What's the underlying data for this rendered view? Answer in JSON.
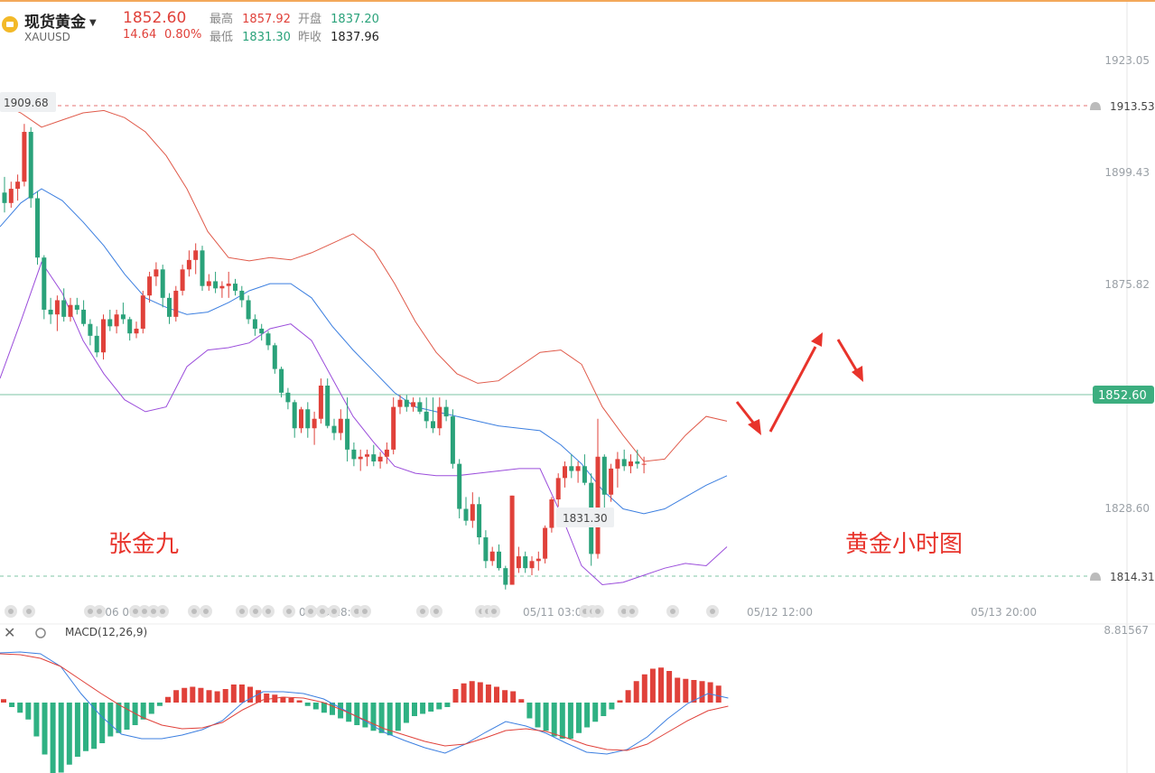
{
  "header": {
    "name": "现货黄金",
    "caret": "▼",
    "code": "XAUUSD",
    "last_price": "1852.60",
    "change": "14.64",
    "change_pct": "0.80%",
    "high_label": "最高",
    "high": "1857.92",
    "open_label": "开盘",
    "open": "1837.20",
    "low_label": "最低",
    "low": "1831.30",
    "prev_close_label": "昨收",
    "prev_close": "1837.96"
  },
  "annotations": {
    "author": "张金九",
    "chart_note": "黄金小时图",
    "max_tag": "1909.68",
    "min_tag": "1831.30",
    "alert_high": "1913.53",
    "alert_low": "1814.31",
    "current_price_tag": "1852.60",
    "macd_label": "MACD(12,26,9)",
    "macd_axis_value": "8.81567"
  },
  "colors": {
    "up": "#e0413a",
    "down": "#2aa27a",
    "boll_upper": "#e05a4a",
    "boll_mid": "#3c7fe0",
    "boll_lower": "#9b4ddb",
    "macd_dif": "#3c7fe0",
    "macd_dea": "#e0413a",
    "price_line": "#7cc6a6",
    "alert_line": "#e57373"
  },
  "chart_data": [
    {
      "type": "candlestick",
      "title": "",
      "y_ticks": [
        "1923.05",
        "1899.43",
        "1875.82",
        "1828.60"
      ],
      "ylim": [
        1808.6,
        1934.0
      ],
      "x_ticks": [
        "05/06 09:00",
        "05/09 18:00",
        "05/11 03:00",
        "05/12 12:00",
        "05/13 20:00"
      ],
      "current_price": 1852.6,
      "alert_levels": [
        1913.53,
        1814.31
      ],
      "candles": [
        [
          1895.2,
          1898.5,
          1891.0,
          1893.0
        ],
        [
          1893.0,
          1897.5,
          1892.0,
          1896.0
        ],
        [
          1896.0,
          1899.0,
          1893.5,
          1897.5
        ],
        [
          1897.5,
          1909.68,
          1896.5,
          1908.0
        ],
        [
          1908.0,
          1909.0,
          1892.0,
          1894.0
        ],
        [
          1894.0,
          1895.5,
          1880.0,
          1881.5
        ],
        [
          1881.5,
          1882.0,
          1868.5,
          1870.5
        ],
        [
          1870.5,
          1873.0,
          1867.5,
          1869.5
        ],
        [
          1869.5,
          1873.5,
          1866.0,
          1872.5
        ],
        [
          1872.5,
          1875.0,
          1868.0,
          1869.0
        ],
        [
          1869.0,
          1873.0,
          1868.0,
          1871.5
        ],
        [
          1871.5,
          1873.0,
          1869.5,
          1870.5
        ],
        [
          1870.5,
          1872.5,
          1867.0,
          1867.5
        ],
        [
          1867.5,
          1868.5,
          1863.0,
          1865.0
        ],
        [
          1865.0,
          1867.0,
          1860.5,
          1861.5
        ],
        [
          1861.5,
          1869.5,
          1860.0,
          1868.5
        ],
        [
          1868.5,
          1870.5,
          1866.0,
          1867.0
        ],
        [
          1867.0,
          1870.5,
          1865.5,
          1869.5
        ],
        [
          1869.5,
          1872.0,
          1867.5,
          1868.5
        ],
        [
          1868.5,
          1869.0,
          1864.0,
          1865.5
        ],
        [
          1865.5,
          1868.0,
          1864.5,
          1866.5
        ],
        [
          1866.5,
          1874.5,
          1865.5,
          1873.5
        ],
        [
          1873.5,
          1878.5,
          1872.0,
          1877.5
        ],
        [
          1877.5,
          1880.5,
          1875.5,
          1879.0
        ],
        [
          1879.0,
          1880.0,
          1871.0,
          1873.0
        ],
        [
          1873.0,
          1874.0,
          1867.5,
          1869.0
        ],
        [
          1869.0,
          1875.5,
          1868.0,
          1874.5
        ],
        [
          1874.5,
          1880.0,
          1873.5,
          1879.0
        ],
        [
          1879.0,
          1883.0,
          1877.5,
          1881.0
        ],
        [
          1881.0,
          1884.5,
          1878.0,
          1883.0
        ],
        [
          1883.0,
          1884.0,
          1874.5,
          1875.5
        ],
        [
          1875.5,
          1878.0,
          1874.5,
          1876.5
        ],
        [
          1876.5,
          1878.5,
          1874.0,
          1875.0
        ],
        [
          1875.0,
          1876.5,
          1873.0,
          1875.5
        ],
        [
          1875.5,
          1878.5,
          1873.0,
          1876.0
        ],
        [
          1876.0,
          1877.0,
          1873.5,
          1874.5
        ],
        [
          1874.5,
          1875.5,
          1871.0,
          1872.5
        ],
        [
          1872.5,
          1873.5,
          1867.5,
          1868.5
        ],
        [
          1868.5,
          1869.5,
          1865.0,
          1866.5
        ],
        [
          1866.5,
          1867.5,
          1864.0,
          1865.5
        ],
        [
          1865.5,
          1866.0,
          1862.0,
          1863.0
        ],
        [
          1863.0,
          1863.5,
          1857.0,
          1858.0
        ],
        [
          1858.0,
          1858.5,
          1852.0,
          1853.0
        ],
        [
          1853.0,
          1854.0,
          1849.5,
          1851.0
        ],
        [
          1851.0,
          1851.5,
          1843.5,
          1845.5
        ],
        [
          1845.5,
          1850.0,
          1844.5,
          1849.5
        ],
        [
          1849.5,
          1851.0,
          1843.5,
          1845.5
        ],
        [
          1845.5,
          1849.0,
          1842.0,
          1847.5
        ],
        [
          1847.5,
          1856.0,
          1846.5,
          1854.5
        ],
        [
          1854.5,
          1856.0,
          1845.5,
          1846.0
        ],
        [
          1846.0,
          1847.5,
          1843.0,
          1844.5
        ],
        [
          1844.5,
          1849.5,
          1843.0,
          1847.5
        ],
        [
          1847.5,
          1852.0,
          1838.5,
          1841.0
        ],
        [
          1841.0,
          1842.5,
          1837.5,
          1839.0
        ],
        [
          1839.0,
          1841.0,
          1836.5,
          1839.5
        ],
        [
          1839.5,
          1841.0,
          1837.5,
          1840.0
        ],
        [
          1840.0,
          1842.0,
          1837.5,
          1838.5
        ],
        [
          1838.5,
          1840.5,
          1837.0,
          1839.5
        ],
        [
          1839.5,
          1842.5,
          1838.0,
          1841.0
        ],
        [
          1841.0,
          1852.0,
          1840.0,
          1850.0
        ],
        [
          1850.0,
          1852.5,
          1848.5,
          1851.5
        ],
        [
          1851.5,
          1852.5,
          1849.0,
          1850.0
        ],
        [
          1850.0,
          1852.0,
          1849.0,
          1851.0
        ],
        [
          1851.0,
          1852.0,
          1848.5,
          1849.0
        ],
        [
          1849.0,
          1852.0,
          1845.5,
          1847.0
        ],
        [
          1847.0,
          1852.0,
          1844.5,
          1845.5
        ],
        [
          1845.5,
          1852.0,
          1844.0,
          1850.0
        ],
        [
          1850.0,
          1851.5,
          1847.0,
          1848.0
        ],
        [
          1848.0,
          1849.5,
          1837.0,
          1838.0
        ],
        [
          1838.0,
          1839.0,
          1826.5,
          1828.5
        ],
        [
          1828.5,
          1831.0,
          1825.0,
          1826.0
        ],
        [
          1826.0,
          1832.0,
          1824.5,
          1829.5
        ],
        [
          1829.5,
          1831.0,
          1821.0,
          1822.5
        ],
        [
          1822.5,
          1824.0,
          1816.0,
          1817.5
        ],
        [
          1817.5,
          1820.5,
          1816.5,
          1819.5
        ],
        [
          1819.5,
          1821.0,
          1815.5,
          1816.0
        ],
        [
          1816.0,
          1816.5,
          1811.5,
          1812.5
        ],
        [
          1812.5,
          1812.8,
          1831.3,
          1831.3
        ],
        [
          1816.0,
          1820.5,
          1815.0,
          1818.5
        ],
        [
          1818.5,
          1819.5,
          1815.0,
          1816.0
        ],
        [
          1816.0,
          1818.5,
          1814.5,
          1817.5
        ],
        [
          1817.5,
          1819.5,
          1815.5,
          1818.0
        ],
        [
          1818.0,
          1825.0,
          1817.0,
          1824.5
        ],
        [
          1824.5,
          1831.0,
          1823.5,
          1830.5
        ],
        [
          1830.5,
          1836.0,
          1829.0,
          1835.0
        ],
        [
          1835.0,
          1838.5,
          1833.0,
          1837.5
        ],
        [
          1837.5,
          1840.0,
          1835.0,
          1836.5
        ],
        [
          1836.5,
          1838.5,
          1834.0,
          1837.5
        ],
        [
          1837.5,
          1840.0,
          1833.5,
          1834.0
        ],
        [
          1834.0,
          1836.0,
          1816.5,
          1819.0
        ],
        [
          1819.0,
          1847.5,
          1818.0,
          1839.5
        ],
        [
          1839.5,
          1840.0,
          1828.5,
          1831.5
        ],
        [
          1831.5,
          1838.0,
          1830.0,
          1837.0
        ],
        [
          1837.0,
          1840.5,
          1833.0,
          1839.0
        ],
        [
          1839.0,
          1841.0,
          1836.5,
          1837.5
        ],
        [
          1837.5,
          1840.0,
          1836.0,
          1838.5
        ],
        [
          1838.5,
          1841.0,
          1837.0,
          1838.0
        ],
        [
          1838.0,
          1839.5,
          1836.0,
          1838.0
        ]
      ],
      "bollinger": {
        "upper": [
          1914.0,
          1912.0,
          1909.0,
          1910.5,
          1912.0,
          1912.5,
          1911.0,
          1908.0,
          1903.0,
          1896.0,
          1887.0,
          1881.5,
          1880.8,
          1881.5,
          1881.0,
          1882.5,
          1884.5,
          1886.5,
          1883.0,
          1876.0,
          1868.0,
          1861.5,
          1857.0,
          1855.0,
          1855.5,
          1858.5,
          1861.5,
          1862.0,
          1859.0,
          1850.0,
          1844.0,
          1838.5,
          1839.0,
          1844.0,
          1848.0,
          1847.0
        ],
        "mid": [
          1888.0,
          1893.0,
          1896.0,
          1893.5,
          1889.0,
          1884.0,
          1878.0,
          1873.0,
          1871.0,
          1869.5,
          1870.0,
          1872.0,
          1874.5,
          1876.0,
          1876.0,
          1873.0,
          1867.0,
          1862.0,
          1857.5,
          1853.0,
          1850.0,
          1849.0,
          1848.0,
          1847.0,
          1846.0,
          1845.5,
          1845.0,
          1842.0,
          1838.0,
          1832.5,
          1828.5,
          1827.5,
          1828.5,
          1831.0,
          1833.5,
          1835.5
        ],
        "lower": [
          1856.0,
          1868.0,
          1880.5,
          1874.0,
          1864.0,
          1857.0,
          1851.5,
          1849.0,
          1850.0,
          1858.5,
          1862.0,
          1862.5,
          1863.5,
          1866.5,
          1867.5,
          1864.0,
          1856.0,
          1848.0,
          1842.5,
          1837.5,
          1836.0,
          1835.5,
          1835.5,
          1836.0,
          1836.5,
          1837.0,
          1837.0,
          1827.5,
          1816.5,
          1812.5,
          1813.0,
          1814.5,
          1816.0,
          1817.0,
          1816.5,
          1820.5
        ]
      },
      "macd": {
        "histogram": [
          0.3,
          -0.4,
          -0.9,
          -1.5,
          -3.0,
          -4.6,
          -6.3,
          -6.2,
          -5.5,
          -4.8,
          -4.3,
          -4.1,
          -3.6,
          -3.0,
          -2.7,
          -2.4,
          -2.0,
          -1.5,
          -1.0,
          -0.3,
          0.5,
          1.1,
          1.3,
          1.4,
          1.3,
          1.1,
          1.0,
          1.2,
          1.6,
          1.6,
          1.4,
          1.1,
          0.8,
          0.7,
          0.5,
          0.4,
          0.2,
          -0.3,
          -0.6,
          -0.9,
          -1.1,
          -1.4,
          -1.7,
          -2.0,
          -2.2,
          -2.5,
          -2.7,
          -2.9,
          -2.5,
          -1.8,
          -1.2,
          -1.0,
          -0.8,
          -0.6,
          -0.4,
          1.2,
          1.7,
          1.9,
          1.8,
          1.6,
          1.4,
          1.1,
          1.0,
          0.3,
          -1.4,
          -2.2,
          -2.5,
          -3.0,
          -3.2,
          -3.2,
          -2.7,
          -2.2,
          -1.7,
          -1.2,
          -0.6,
          0.2,
          1.1,
          1.9,
          2.5,
          3.0,
          3.1,
          2.8,
          2.2,
          2.1,
          2.0,
          1.9,
          1.8,
          1.5
        ],
        "dif": [
          5.5,
          5.6,
          5.4,
          4.0,
          1.0,
          -1.5,
          -3.5,
          -4.0,
          -4.0,
          -3.6,
          -3.0,
          -2.0,
          0.0,
          1.2,
          1.2,
          1.0,
          0.4,
          -0.8,
          -2.0,
          -3.3,
          -4.2,
          -5.0,
          -5.6,
          -4.6,
          -3.3,
          -2.1,
          -2.6,
          -3.4,
          -4.5,
          -5.5,
          -5.7,
          -5.2,
          -3.8,
          -1.8,
          -0.1,
          1.0,
          0.5
        ],
        "dea": [
          5.4,
          5.3,
          4.9,
          4.0,
          2.5,
          1.0,
          -0.4,
          -1.6,
          -2.5,
          -2.9,
          -2.8,
          -2.2,
          -0.8,
          0.3,
          0.6,
          0.5,
          0.0,
          -0.9,
          -1.9,
          -2.9,
          -3.6,
          -4.3,
          -4.8,
          -4.6,
          -3.9,
          -3.1,
          -2.9,
          -3.2,
          -3.9,
          -4.7,
          -5.2,
          -5.3,
          -4.6,
          -3.3,
          -2.0,
          -0.9,
          -0.4
        ]
      }
    }
  ]
}
